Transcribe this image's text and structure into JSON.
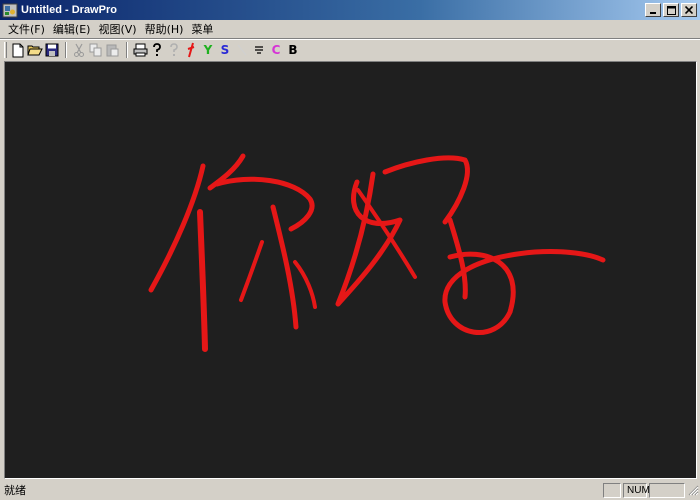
{
  "window": {
    "title": "Untitled - DrawPro",
    "buttons": {
      "minimize": "_",
      "maximize": "□",
      "close": "✕"
    }
  },
  "menu": {
    "items": [
      {
        "label": "文件(F)"
      },
      {
        "label": "编辑(E)"
      },
      {
        "label": "视图(V)"
      },
      {
        "label": "帮助(H)"
      },
      {
        "label": "菜单"
      }
    ]
  },
  "toolbar": {
    "text_tools": [
      {
        "label": "Y",
        "color": "#1fb11f"
      },
      {
        "label": "S",
        "color": "#2a2ad6"
      },
      {
        "label": "C",
        "color": "#d633d6"
      },
      {
        "label": "B",
        "color": "#000000"
      }
    ],
    "icons": [
      "new-file-icon",
      "open-folder-icon",
      "save-icon",
      "cut-icon",
      "copy-icon",
      "paste-icon",
      "print-icon",
      "help-icon",
      "help-disabled-icon",
      "red-pen-icon",
      "line-icon",
      "align-icon"
    ]
  },
  "canvas": {
    "background": "#1f1f1f",
    "stroke_color": "#e51717",
    "ink_text": "你好"
  },
  "status": {
    "text": "就绪",
    "num_indicator": "NUM"
  }
}
